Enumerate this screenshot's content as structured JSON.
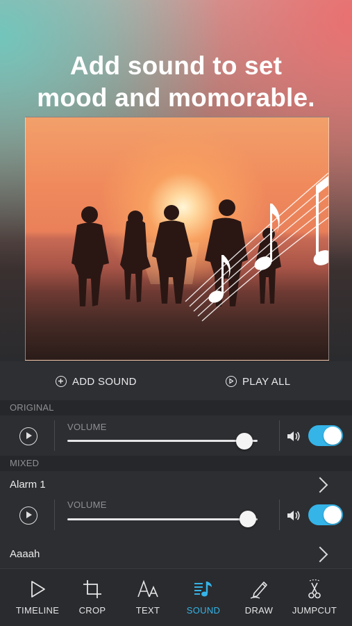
{
  "promo": {
    "headline_line1": "Add sound to set",
    "headline_line2": "mood and momorable."
  },
  "actions": {
    "add_sound": "ADD SOUND",
    "play_all": "PLAY ALL"
  },
  "original": {
    "section_label": "ORIGINAL",
    "volume_label": "VOLUME",
    "volume": 0.93,
    "enabled": true
  },
  "mixed": {
    "section_label": "MIXED",
    "tracks": [
      {
        "name": "Alarm 1",
        "volume_label": "VOLUME",
        "volume": 0.95,
        "enabled": true
      },
      {
        "name": "Aaaah"
      }
    ]
  },
  "tabs": [
    {
      "label": "TIMELINE",
      "icon": "play-triangle-icon",
      "active": false
    },
    {
      "label": "CROP",
      "icon": "crop-icon",
      "active": false
    },
    {
      "label": "TEXT",
      "icon": "text-aa-icon",
      "active": false
    },
    {
      "label": "SOUND",
      "icon": "music-note-icon",
      "active": true
    },
    {
      "label": "DRAW",
      "icon": "pencil-icon",
      "active": false
    },
    {
      "label": "JUMPCUT",
      "icon": "scissors-icon",
      "active": false
    }
  ],
  "colors": {
    "accent": "#35b4e8",
    "panel": "#2d2e31",
    "section": "#26272a"
  }
}
